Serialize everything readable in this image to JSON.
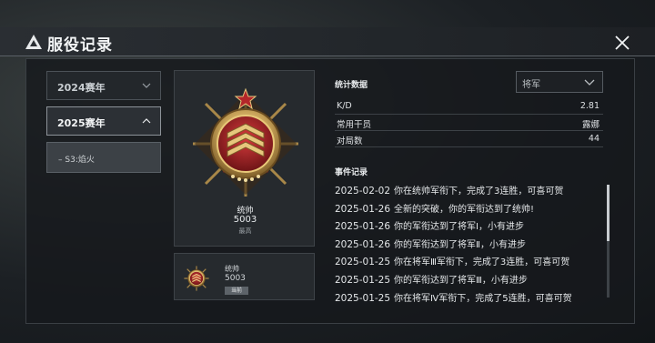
{
  "window": {
    "title": "服役记录",
    "logo_icon": "triangle-a-logo-icon",
    "close_icon": "close-icon"
  },
  "seasons": [
    {
      "label": "2024赛年",
      "expanded": false
    },
    {
      "label": "2025赛年",
      "expanded": true,
      "sub_items": [
        {
          "label": "S3:焰火"
        }
      ]
    }
  ],
  "rank_card": {
    "emblem": "commander-rank-emblem",
    "name": "统帅",
    "score": "5003",
    "tag": "最高"
  },
  "current_card": {
    "emblem": "commander-rank-emblem-small",
    "name": "统帅",
    "score": "5003",
    "badge": "当前"
  },
  "stats": {
    "title": "统计数据",
    "filter": {
      "selected": "将军"
    },
    "rows": [
      {
        "label": "K/D",
        "value": "2.81"
      },
      {
        "label": "常用干员",
        "value": "露娜"
      },
      {
        "label": "对局数",
        "value": "44"
      }
    ]
  },
  "events": {
    "title": "事件记录",
    "items": [
      {
        "date": "2025-02-02",
        "text": "你在统帅军衔下，完成了3连胜，可喜可贺"
      },
      {
        "date": "2025-01-26",
        "text": "全新的突破，你的军衔达到了统帅!"
      },
      {
        "date": "2025-01-26",
        "text": "你的军衔达到了将军Ⅰ，小有进步"
      },
      {
        "date": "2025-01-26",
        "text": "你的军衔达到了将军Ⅱ，小有进步"
      },
      {
        "date": "2025-01-25",
        "text": "你在将军Ⅲ军衔下，完成了3连胜，可喜可贺"
      },
      {
        "date": "2025-01-25",
        "text": "你的军衔达到了将军Ⅲ，小有进步"
      },
      {
        "date": "2025-01-25",
        "text": "你在将军Ⅳ军衔下，完成了5连胜，可喜可贺"
      }
    ]
  },
  "colors": {
    "gold": "#c9a45a",
    "red": "#a3262a",
    "panel": "#262a2e"
  }
}
